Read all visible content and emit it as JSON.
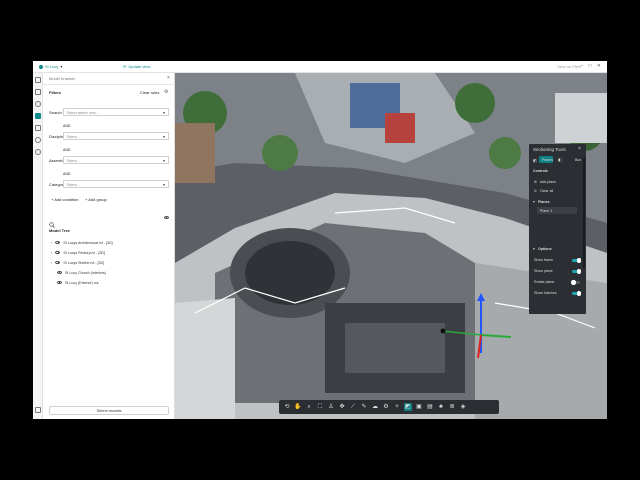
{
  "topbar": {
    "project": "St Lucy",
    "update_view": "Update view",
    "view_others": "View on Files"
  },
  "panel": {
    "header": "Model browser",
    "filters_title": "Filters",
    "clear_rules": "Clear rules",
    "search_sets_label": "Search sets",
    "search_sets_placeholder": "Select search sets...",
    "and_1": "AND",
    "disciplines_label": "Disciplines",
    "disciplines_placeholder": "Select...",
    "and_2": "AND",
    "assembly_label": "Assembly",
    "assembly_placeholder": "Select...",
    "and_3": "AND",
    "categories_label": "Categories",
    "categories_placeholder": "Select...",
    "add_condition": "Add condition",
    "add_group": "Add group",
    "model_tree_title": "Model Tree",
    "tree": [
      {
        "label": "St Lucys Architectural.rvt - [3D]",
        "expandable": true
      },
      {
        "label": "St Lucys Rectory.rvt - [3D]",
        "expandable": true
      },
      {
        "label": "St Lucys Shelter.rvt - [3D]",
        "expandable": true
      },
      {
        "label": "St Lucy Church (Interiors)",
        "expandable": false
      },
      {
        "label": "St Lucy (Exterior).rcs",
        "expandable": false
      }
    ],
    "select_models": "Select models"
  },
  "section_tools": {
    "title": "Sectioning Tools",
    "tab_planes": "Planes",
    "tab_box": "Box",
    "controls": "Controls",
    "add_plane": "Add plane",
    "clear_all": "Clear all",
    "planes_title": "Planes",
    "plane_1": "Plane 1",
    "options": "Options",
    "show_frame": "Show frame",
    "show_plane": "Show plane",
    "rotate_plane": "Rotate plane",
    "show_hatches": "Show hatches",
    "toggles": {
      "show_frame": true,
      "show_plane": true,
      "rotate_plane": false,
      "show_hatches": true
    }
  },
  "toolbar": {
    "icons": [
      "rotate-icon",
      "pan-icon",
      "zoom-icon",
      "fit-icon",
      "walk-icon",
      "gizmo-icon",
      "measure-icon",
      "pen-icon",
      "cloud-icon",
      "settings-icon",
      "explode-icon",
      "section-icon",
      "box-icon",
      "image-icon",
      "forest-icon",
      "layers-icon",
      "tag-icon"
    ],
    "active": "section-icon"
  },
  "colors": {
    "accent": "#0a8a8a",
    "panel_dark": "#2b2e32",
    "toggle_on": "#1aa7b2"
  }
}
